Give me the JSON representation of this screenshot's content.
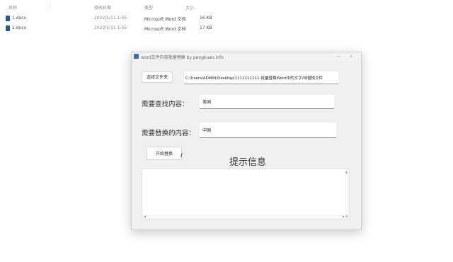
{
  "explorer": {
    "headers": {
      "name": "名称",
      "date": "修改日期",
      "type": "类型",
      "size": "大小"
    },
    "files": [
      {
        "name": "1.docx",
        "date": "2022/5/11 1:55",
        "type": "Microsoft Word 文档",
        "size": "16 KB"
      },
      {
        "name": "2.docx",
        "date": "2022/5/11 1:55",
        "type": "Microsoft Word 文档",
        "size": "17 KB"
      }
    ]
  },
  "window": {
    "title": "word文件内容批量替换   by pengkuan.info",
    "controls": {
      "minimize": "—",
      "close": "✕"
    },
    "open_button": "选择文件夹",
    "folder_path": "C:/Users/ADMIN/Desktop/1111111111-批量替换Word中的文字/待替换文件",
    "find_label": "需要查找内容：",
    "find_value": "美国",
    "replace_label": "需要替换的内容：",
    "replace_value": "中国",
    "replace_button": "开始替换",
    "prompt_title": "提示信息",
    "output_text": ""
  },
  "colors": {
    "window_bg": "#f0f0f0",
    "app_icon": "#3a6fb5",
    "word_icon": "#2b579a"
  }
}
